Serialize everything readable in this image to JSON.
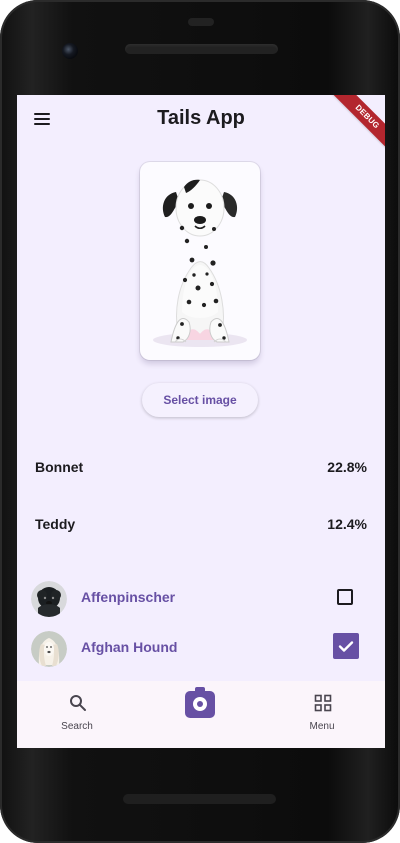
{
  "app": {
    "title": "Tails App",
    "debug_badge": "DEBUG"
  },
  "hero": {
    "image_icon": "dalmatian-puppy-image",
    "select_button_label": "Select image"
  },
  "predictions": [
    {
      "label": "Bonnet",
      "value": "22.8%"
    },
    {
      "label": "Teddy",
      "value": "12.4%"
    }
  ],
  "breeds": [
    {
      "name": "Affenpinscher",
      "checked": false,
      "avatar": "affenpinscher-avatar"
    },
    {
      "name": "Afghan Hound",
      "checked": true,
      "avatar": "afghan-hound-avatar"
    }
  ],
  "bottom_nav": {
    "search_label": "Search",
    "menu_label": "Menu",
    "center_icon": "camera-icon"
  },
  "colors": {
    "background": "#f3eefe",
    "accent": "#6750a4",
    "text": "#1c1b1f",
    "debug": "#b3262e"
  }
}
